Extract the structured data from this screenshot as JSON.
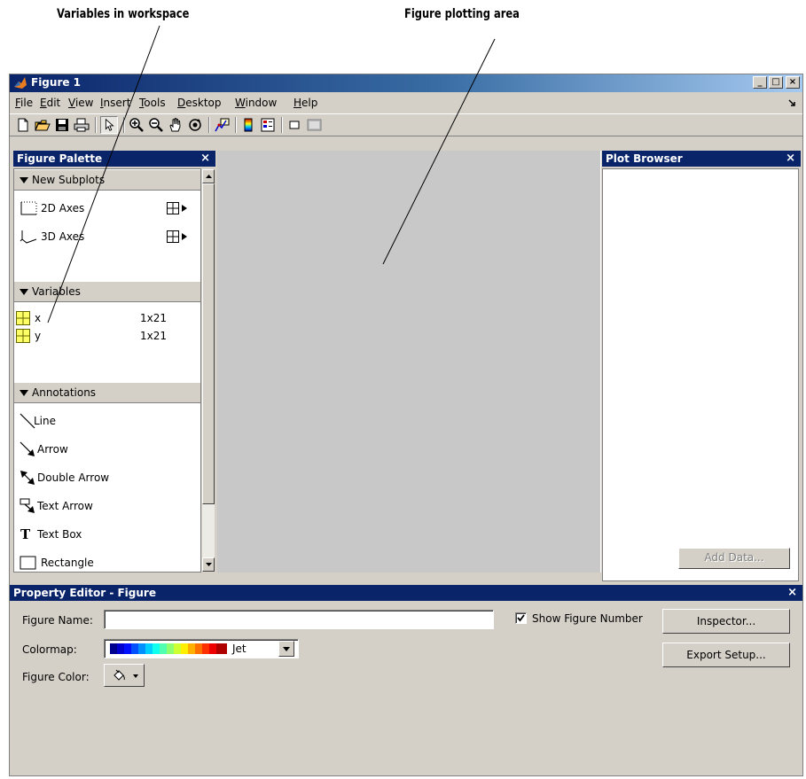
{
  "callouts": {
    "variables": "Variables in workspace",
    "plotting_area": "Figure plotting area"
  },
  "window": {
    "title": "Figure 1",
    "controls": [
      "_",
      "□",
      "×"
    ]
  },
  "menubar": {
    "items": [
      "File",
      "Edit",
      "View",
      "Insert",
      "Tools",
      "Desktop",
      "Window",
      "Help"
    ],
    "underlines": [
      "F",
      "E",
      "V",
      "I",
      "T",
      "D",
      "W",
      "H"
    ]
  },
  "toolbar": {
    "icons": [
      "new-figure-icon",
      "open-file-icon",
      "save-icon",
      "print-icon",
      "edit-plot-arrow-icon",
      "zoom-in-icon",
      "zoom-out-icon",
      "pan-hand-icon",
      "rotate-3d-icon",
      "data-cursor-icon",
      "insert-colorbar-icon",
      "insert-legend-icon",
      "hide-plot-tools-icon",
      "show-plot-tools-icon"
    ]
  },
  "figure_palette": {
    "title": "Figure Palette",
    "close": "×",
    "sections": {
      "new_subplots": {
        "label": "New Subplots",
        "items": [
          {
            "label": "2D Axes"
          },
          {
            "label": "3D Axes"
          }
        ]
      },
      "variables": {
        "label": "Variables",
        "items": [
          {
            "name": "x",
            "size": "1x21"
          },
          {
            "name": "y",
            "size": "1x21"
          }
        ]
      },
      "annotations": {
        "label": "Annotations",
        "items": [
          {
            "label": "Line"
          },
          {
            "label": "Arrow"
          },
          {
            "label": "Double Arrow"
          },
          {
            "label": "Text Arrow"
          },
          {
            "label": "Text Box"
          },
          {
            "label": "Rectangle"
          }
        ]
      }
    }
  },
  "plot_browser": {
    "title": "Plot Browser",
    "close": "×",
    "add_data_label": "Add Data..."
  },
  "property_editor": {
    "title": "Property Editor - Figure",
    "close": "×",
    "figure_name_label": "Figure Name:",
    "figure_name_value": "",
    "show_figure_number_label": "Show Figure Number",
    "show_figure_number_checked": true,
    "colormap_label": "Colormap:",
    "colormap_value": "Jet",
    "figure_color_label": "Figure Color:",
    "inspector_label": "Inspector...",
    "export_setup_label": "Export Setup..."
  },
  "colors": {
    "title_bar_start": "#0a246a",
    "title_bar_end": "#a6caf0",
    "panel_title": "#0a246a",
    "window_face": "#d4d0c8",
    "plot_area": "#c8c8c8",
    "variable_icon": "#ffff66"
  }
}
